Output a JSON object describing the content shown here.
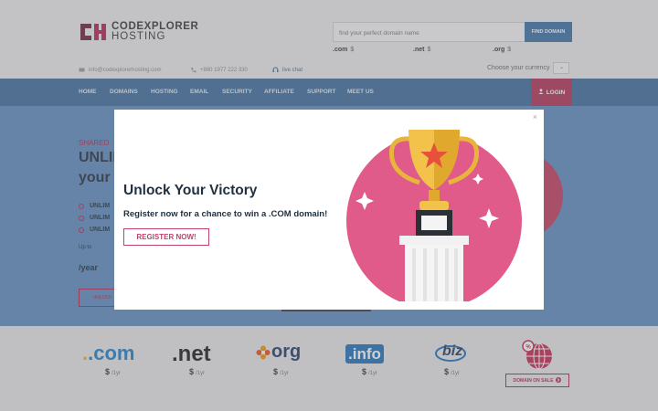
{
  "header": {
    "logo_top": "CODEXPLORER",
    "logo_bottom": "HOSTING",
    "search_placeholder": "find your perfect domain name",
    "search_button": "FIND DOMAIN",
    "tlds": [
      {
        "name": ".com",
        "price": "$"
      },
      {
        "name": ".net",
        "price": "$"
      },
      {
        "name": ".org",
        "price": "$"
      }
    ],
    "email": "info@codexplorerhosting.com",
    "phone": "+880 1977 222 330",
    "chat": "live chat",
    "currency_label": "Choose your currency"
  },
  "nav": {
    "items": [
      "HOME",
      "DOMAINS",
      "HOSTING",
      "EMAIL",
      "SECURITY",
      "AFFILIATE",
      "SUPPORT",
      "MEET US"
    ],
    "login": "LOGIN"
  },
  "hero": {
    "tag": "SHARED",
    "headline1": "UNLIM",
    "headline2": "your",
    "features": [
      "UNLIM",
      "UNLIM",
      "UNLIM"
    ],
    "upto": "Up to",
    "year": "/year",
    "button": "UNLOCK"
  },
  "modal": {
    "title": "Unlock Your Victory",
    "subtitle": "Register now for a chance to win a .COM domain!",
    "button": "REGISTER NOW!",
    "close": "×"
  },
  "tld_strip": {
    "items": [
      {
        "name": ".com",
        "price": "$",
        "unit": "/1yr"
      },
      {
        "name": ".net",
        "price": "$",
        "unit": "/1yr"
      },
      {
        "name": "org",
        "price": "$",
        "unit": "/1yr"
      },
      {
        "name": ".info",
        "price": "$",
        "unit": "/1yr"
      },
      {
        "name": "biz",
        "price": "$",
        "unit": "/1yr"
      }
    ],
    "sale_button": "DOMAIN ON SALE"
  }
}
